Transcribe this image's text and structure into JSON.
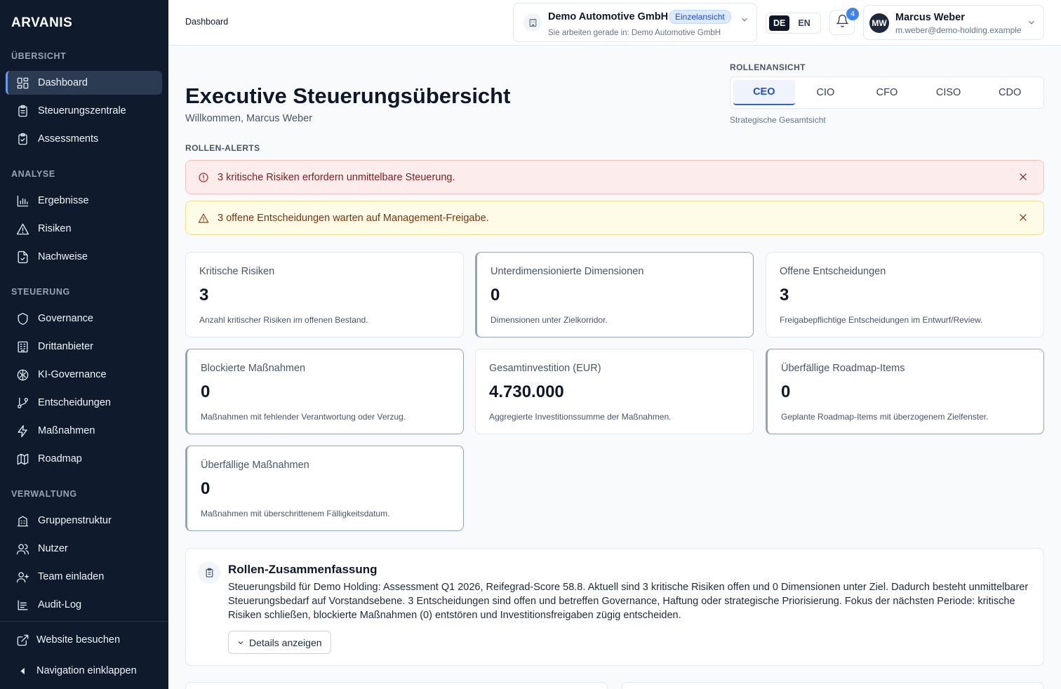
{
  "sidebar": {
    "brand": "ARVANIS",
    "sections": [
      "ÜBERSICHT",
      "ANALYSE",
      "STEUERUNG",
      "VERWALTUNG"
    ],
    "items": [
      {
        "label": "Dashboard",
        "icon": "dashboard-icon",
        "active": true
      },
      {
        "label": "Steuerungszentrale",
        "icon": "clipboard-icon"
      },
      {
        "label": "Assessments",
        "icon": "clipboard-check-icon"
      },
      {
        "label": "Ergebnisse",
        "icon": "bar-chart-icon"
      },
      {
        "label": "Risiken",
        "icon": "warning-icon"
      },
      {
        "label": "Nachweise",
        "icon": "file-check-icon"
      },
      {
        "label": "Governance",
        "icon": "shield-icon"
      },
      {
        "label": "Drittanbieter",
        "icon": "building-icon"
      },
      {
        "label": "KI-Governance",
        "icon": "brain-icon"
      },
      {
        "label": "Entscheidungen",
        "icon": "git-branch-icon"
      },
      {
        "label": "Maßnahmen",
        "icon": "lightning-icon"
      },
      {
        "label": "Roadmap",
        "icon": "map-icon"
      },
      {
        "label": "Gruppenstruktur",
        "icon": "org-building-icon"
      },
      {
        "label": "Nutzer",
        "icon": "users-icon"
      },
      {
        "label": "Team einladen",
        "icon": "user-plus-icon"
      },
      {
        "label": "Audit-Log",
        "icon": "log-icon"
      }
    ],
    "website": "Website besuchen",
    "collapse": "Navigation einklappen"
  },
  "header": {
    "breadcrumb": "Dashboard",
    "tenant": {
      "name": "Demo Automotive GmbH",
      "badge": "Einzelansicht",
      "subtitle": "Sie arbeiten gerade in: Demo Automotive GmbH"
    },
    "languages": [
      "DE",
      "EN"
    ],
    "active_language": "DE",
    "notification_count": "4",
    "user": {
      "initials": "MW",
      "name": "Marcus Weber",
      "email": "m.weber@demo-holding.example"
    }
  },
  "main": {
    "title": "Executive Steuerungsübersicht",
    "welcome": "Willkommen, Marcus Weber",
    "role_label": "ROLLENANSICHT",
    "roles": [
      "CEO",
      "CIO",
      "CFO",
      "CISO",
      "CDO"
    ],
    "active_role": "CEO",
    "role_description": "Strategische Gesamtsicht",
    "alerts_label": "ROLLEN-ALERTS",
    "alerts": [
      {
        "text": "3 kritische Risiken erfordern unmittelbare Steuerung.",
        "severity": "critical",
        "color": "#fdecec"
      },
      {
        "text": "3 offene Entscheidungen warten auf Management-Freigabe.",
        "severity": "warning",
        "color": "#fefbe7"
      }
    ],
    "kpis": [
      {
        "title": "Kritische Risiken",
        "value": "3",
        "desc": "Anzahl kritischer Risiken im offenen Bestand."
      },
      {
        "title": "Unterdimensionierte Dimensionen",
        "value": "0",
        "desc": "Dimensionen unter Zielkorridor."
      },
      {
        "title": "Offene Entscheidungen",
        "value": "3",
        "desc": "Freigabepflichtige Entscheidungen im Entwurf/Review."
      },
      {
        "title": "Blockierte Maßnahmen",
        "value": "0",
        "desc": "Maßnahmen mit fehlender Verantwortung oder Verzug."
      },
      {
        "title": "Gesamtinvestition (EUR)",
        "value": "4.730.000",
        "desc": "Aggregierte Investitionssumme der Maßnahmen."
      },
      {
        "title": "Überfällige Roadmap-Items",
        "value": "0",
        "desc": "Geplante Roadmap-Items mit überzogenem Zielfenster."
      },
      {
        "title": "Überfällige Maßnahmen",
        "value": "0",
        "desc": "Maßnahmen mit überschrittenem Fälligkeitsdatum."
      }
    ],
    "summary": {
      "title": "Rollen-Zusammenfassung",
      "body": "Steuerungsbild für Demo Holding: Assessment Q1 2026, Reifegrad-Score 58.8. Aktuell sind 3 kritische Risiken offen und 0 Dimensionen unter Ziel. Dadurch besteht unmittelbarer Steuerungsbedarf auf Vorstandsebene. 3 Entscheidungen sind offen und betreffen Governance, Haftung oder strategische Priorisierung. Fokus der nächsten Periode: kritische Risiken schließen, blockierte Maßnahmen (0) entstören und Investitionsfreigaben zügig entscheiden.",
      "button": "Details anzeigen"
    }
  },
  "colors": {
    "sidebar_bg": "#0f1b2d",
    "accent": "#2563eb",
    "alert_critical": "#b91c1c",
    "alert_warning": "#92400e"
  }
}
